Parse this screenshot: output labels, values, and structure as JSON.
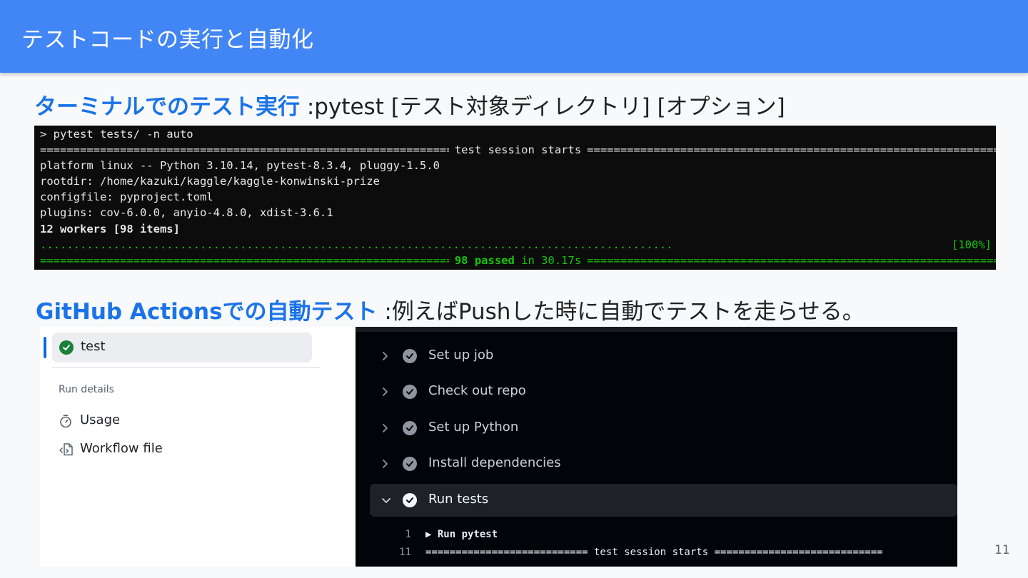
{
  "slide": {
    "title": "テストコードの実行と自動化",
    "page_number": "11"
  },
  "section1": {
    "heading": "ターミナルでのテスト実行",
    "description": ":pytest [テスト対象ディレクトリ] [オプション]"
  },
  "terminal": {
    "command": "> pytest tests/ -n auto",
    "session_header": "test session starts",
    "lines": [
      "platform linux -- Python 3.10.14, pytest-8.3.4, pluggy-1.5.0",
      "rootdir: /home/kazuki/kaggle/kaggle-konwinski-prize",
      "configfile: pyproject.toml",
      "plugins: cov-6.0.0, anyio-4.8.0, xdist-3.6.1"
    ],
    "workers_line": "12 workers [98 items]",
    "progress": "[100%]",
    "result_passed": "98 passed",
    "result_time": "in 30.17s",
    "colors": {
      "green": "#16c60c",
      "background": "#0c0c0c"
    }
  },
  "section2": {
    "heading": "GitHub Actionsでの自動テスト",
    "description": ":例えばPushした時に自動でテストを走らせる。"
  },
  "github_sidebar": {
    "job_name": "test",
    "job_status_icon": "check-circle-icon",
    "run_details_label": "Run details",
    "nav": [
      {
        "label": "Usage",
        "icon": "stopwatch-icon"
      },
      {
        "label": "Workflow file",
        "icon": "workflow-file-icon"
      }
    ]
  },
  "github_steps": {
    "steps": [
      {
        "label": "Set up job",
        "expanded": false
      },
      {
        "label": "Check out repo",
        "expanded": false
      },
      {
        "label": "Set up Python",
        "expanded": false
      },
      {
        "label": "Install dependencies",
        "expanded": false
      },
      {
        "label": "Run tests",
        "expanded": true
      }
    ],
    "log_lines": [
      {
        "line_no": "1",
        "text": "▶ Run pytest"
      },
      {
        "line_no": "11",
        "text": "=========================== test session starts ============================"
      }
    ]
  }
}
